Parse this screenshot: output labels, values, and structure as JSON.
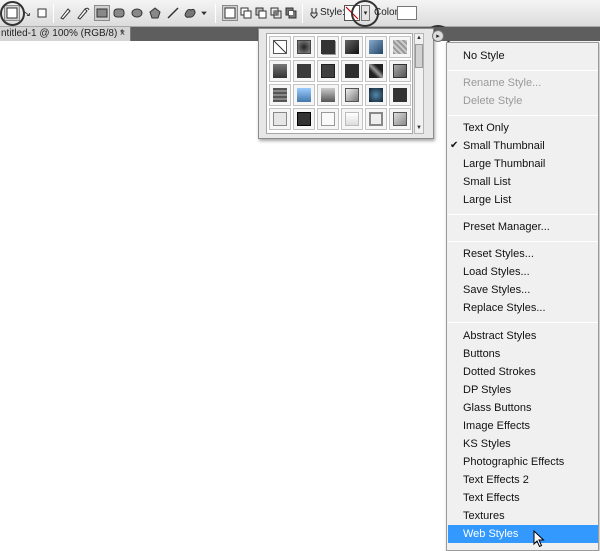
{
  "options_bar": {
    "style_label": "Style:",
    "color_label": "Color:"
  },
  "document": {
    "tab_title": "ntitled-1 @ 100% (RGB/8) *",
    "close_glyph": "×"
  },
  "picker": {
    "scroll_up": "▲",
    "scroll_down": "▼",
    "flyout_glyph": "▸"
  },
  "menu": {
    "no_style": "No Style",
    "rename_style": "Rename Style...",
    "delete_style": "Delete Style",
    "text_only": "Text Only",
    "small_thumbnail": "Small Thumbnail",
    "small_thumbnail_check": "✔",
    "large_thumbnail": "Large Thumbnail",
    "small_list": "Small List",
    "large_list": "Large List",
    "preset_manager": "Preset Manager...",
    "reset_styles": "Reset Styles...",
    "load_styles": "Load Styles...",
    "save_styles": "Save Styles...",
    "replace_styles": "Replace Styles...",
    "libraries": [
      "Abstract Styles",
      "Buttons",
      "Dotted Strokes",
      "DP Styles",
      "Glass Buttons",
      "Image Effects",
      "KS Styles",
      "Photographic Effects",
      "Text Effects 2",
      "Text Effects",
      "Textures",
      "Web Styles"
    ]
  },
  "colors": {
    "menu_highlight": "#3399ff",
    "document_bg": "#ffffff",
    "tab_bar": "#5e5e5e"
  }
}
